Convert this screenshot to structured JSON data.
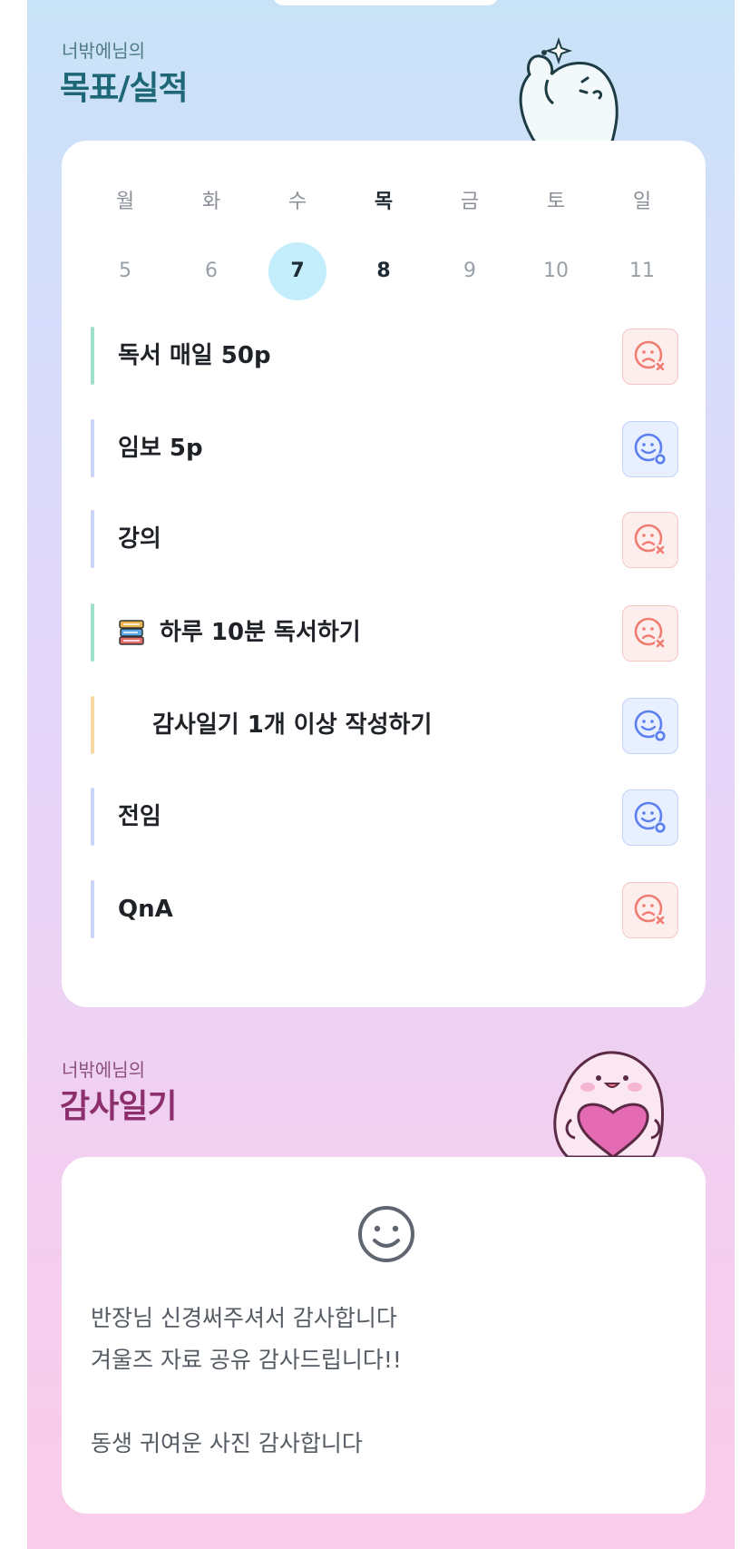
{
  "goals_section": {
    "subtitle": "너밖에님의",
    "title": "목표/실적"
  },
  "week": {
    "days": [
      {
        "dow": "월",
        "num": "5"
      },
      {
        "dow": "화",
        "num": "6"
      },
      {
        "dow": "수",
        "num": "7"
      },
      {
        "dow": "목",
        "num": "8"
      },
      {
        "dow": "금",
        "num": "9"
      },
      {
        "dow": "토",
        "num": "10"
      },
      {
        "dow": "일",
        "num": "11"
      }
    ],
    "selected_index": 2,
    "today_index": 3
  },
  "goals": [
    {
      "label": "독서 매일 50p",
      "status": "fail",
      "bar_color": "#9fe0c8"
    },
    {
      "label": "임보 5p",
      "status": "success",
      "bar_color": "#c9d4f6"
    },
    {
      "label": "강의",
      "status": "fail",
      "bar_color": "#c9d4f6"
    },
    {
      "label": "하루 10분 독서하기",
      "status": "fail",
      "bar_color": "#9fe0c8",
      "icon": "book-stack-icon"
    },
    {
      "label": "감사일기 1개 이상 작성하기",
      "status": "success",
      "bar_color": "#f7d9a6"
    },
    {
      "label": "전임",
      "status": "success",
      "bar_color": "#c9d4f6"
    },
    {
      "label": "QnA",
      "status": "fail",
      "bar_color": "#c9d4f6"
    }
  ],
  "gratitude_section": {
    "subtitle": "너밖에님의",
    "title": "감사일기"
  },
  "gratitude": {
    "mood_icon": "smile-face-icon",
    "lines": [
      "반장님 신경써주셔서 감사합니다",
      "겨울즈 자료 공유 감사드립니다!!",
      "",
      "동생 귀여운 사진 감사합니다"
    ]
  },
  "colors": {
    "fail": "#ef7d72",
    "success": "#5b80ee",
    "today_highlight": "#c4eefb"
  }
}
